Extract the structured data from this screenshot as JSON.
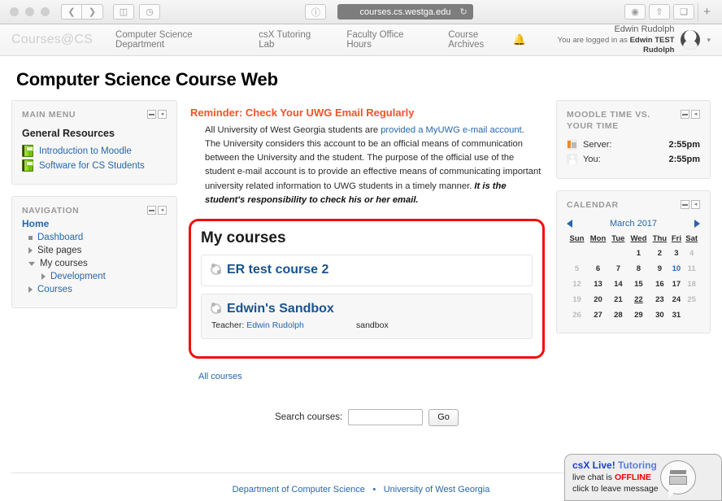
{
  "browser": {
    "url": "courses.cs.westga.edu",
    "back_icon": "chevron-left-icon",
    "forward_icon": "chevron-right-icon",
    "sidebar_icon": "sidebar-icon",
    "history_icon": "clock-icon",
    "reader_icon": "reader-icon",
    "reload_icon": "reload-icon",
    "download_icon": "download-icon",
    "share_icon": "share-icon",
    "tabs_icon": "tab-overview-icon",
    "newtab_label": "+"
  },
  "site_header": {
    "brand": "Courses@CS",
    "nav": [
      {
        "label": "Computer Science Department"
      },
      {
        "label": "csX Tutoring Lab"
      },
      {
        "label": "Faculty Office Hours"
      },
      {
        "label": "Course Archives"
      }
    ],
    "bell_icon": "notification-bell-icon",
    "user_name": "Edwin Rudolph",
    "logged_in_prefix": "You are logged in as ",
    "logged_in_user": "Edwin TEST Rudolph",
    "caret_icon": "chevron-down-icon"
  },
  "page": {
    "title": "Computer Science Course Web"
  },
  "main_menu": {
    "title": "Main menu",
    "collapse_icon": "minus-icon",
    "dock_icon": "dock-left-icon",
    "section_title": "General Resources",
    "resources": [
      {
        "label": "Introduction to Moodle",
        "icon": "book-resource-icon"
      },
      {
        "label": "Software for CS Students",
        "icon": "book-resource-icon"
      }
    ]
  },
  "navigation": {
    "title": "Navigation",
    "collapse_icon": "minus-icon",
    "dock_icon": "dock-left-icon",
    "home": "Home",
    "items": [
      {
        "label": "Dashboard",
        "marker": "square",
        "level": 1,
        "link": true
      },
      {
        "label": "Site pages",
        "marker": "collapsed",
        "level": 1,
        "link": false
      },
      {
        "label": "My courses",
        "marker": "expanded",
        "level": 1,
        "link": false
      },
      {
        "label": "Development",
        "marker": "collapsed",
        "level": 2,
        "link": true
      },
      {
        "label": "Courses",
        "marker": "collapsed",
        "level": 1,
        "link": true
      }
    ]
  },
  "reminder": {
    "title": "Reminder: Check Your UWG Email Regularly",
    "text_1": "All University of West Georgia students are ",
    "link": "provided a MyUWG e-mail account",
    "text_2": ".  The University considers this account to be an official means of communication between the University and the student. The purpose of the official use of the student e-mail account is to provide an effective means of communicating important university related information to UWG students in a timely manner. ",
    "emphasis": "It is the student's responsibility to check his or her email."
  },
  "my_courses": {
    "heading": "My courses",
    "highlight_color": "#f20d0d",
    "courses": [
      {
        "name": "ER test course 2",
        "icon": "course-icon",
        "teacher_label": "",
        "teacher_name": "",
        "summary": ""
      },
      {
        "name": "Edwin's Sandbox",
        "icon": "course-icon",
        "teacher_label": "Teacher: ",
        "teacher_name": "Edwin Rudolph",
        "summary": "sandbox"
      }
    ],
    "all_courses_label": "All courses"
  },
  "course_search": {
    "label": "Search courses:",
    "value": "",
    "placeholder": "",
    "button_label": "Go"
  },
  "moodle_time": {
    "title": "Moodle time vs. your time",
    "collapse_icon": "minus-icon",
    "dock_icon": "dock-left-icon",
    "rows": [
      {
        "label": "Server:",
        "value": "2:55pm",
        "icon": "server-icon"
      },
      {
        "label": "You:",
        "value": "2:55pm",
        "icon": "user-icon"
      }
    ]
  },
  "calendar": {
    "title": "Calendar",
    "collapse_icon": "minus-icon",
    "dock_icon": "dock-left-icon",
    "prev_icon": "arrow-left-icon",
    "next_icon": "arrow-right-icon",
    "month": "March 2017",
    "daynames": [
      "Sun",
      "Mon",
      "Tue",
      "Wed",
      "Thu",
      "Fri",
      "Sat"
    ],
    "weeks": [
      [
        {
          "d": "",
          "weekend": false,
          "today": false,
          "marked": false
        },
        {
          "d": "",
          "weekend": false,
          "today": false,
          "marked": false
        },
        {
          "d": "",
          "weekend": false,
          "today": false,
          "marked": false
        },
        {
          "d": "1",
          "weekend": false,
          "today": false,
          "marked": false
        },
        {
          "d": "2",
          "weekend": false,
          "today": false,
          "marked": false
        },
        {
          "d": "3",
          "weekend": false,
          "today": false,
          "marked": false
        },
        {
          "d": "4",
          "weekend": true,
          "today": false,
          "marked": false
        }
      ],
      [
        {
          "d": "5",
          "weekend": true,
          "today": false,
          "marked": false
        },
        {
          "d": "6",
          "weekend": false,
          "today": false,
          "marked": false
        },
        {
          "d": "7",
          "weekend": false,
          "today": false,
          "marked": false
        },
        {
          "d": "8",
          "weekend": false,
          "today": false,
          "marked": false
        },
        {
          "d": "9",
          "weekend": false,
          "today": false,
          "marked": false
        },
        {
          "d": "10",
          "weekend": false,
          "today": true,
          "marked": false
        },
        {
          "d": "11",
          "weekend": true,
          "today": false,
          "marked": false
        }
      ],
      [
        {
          "d": "12",
          "weekend": true,
          "today": false,
          "marked": false
        },
        {
          "d": "13",
          "weekend": false,
          "today": false,
          "marked": false
        },
        {
          "d": "14",
          "weekend": false,
          "today": false,
          "marked": false
        },
        {
          "d": "15",
          "weekend": false,
          "today": false,
          "marked": false
        },
        {
          "d": "16",
          "weekend": false,
          "today": false,
          "marked": false
        },
        {
          "d": "17",
          "weekend": false,
          "today": false,
          "marked": false
        },
        {
          "d": "18",
          "weekend": true,
          "today": false,
          "marked": false
        }
      ],
      [
        {
          "d": "19",
          "weekend": true,
          "today": false,
          "marked": false
        },
        {
          "d": "20",
          "weekend": false,
          "today": false,
          "marked": false
        },
        {
          "d": "21",
          "weekend": false,
          "today": false,
          "marked": false
        },
        {
          "d": "22",
          "weekend": false,
          "today": false,
          "marked": true
        },
        {
          "d": "23",
          "weekend": false,
          "today": false,
          "marked": false
        },
        {
          "d": "24",
          "weekend": false,
          "today": false,
          "marked": false
        },
        {
          "d": "25",
          "weekend": true,
          "today": false,
          "marked": false
        }
      ],
      [
        {
          "d": "26",
          "weekend": true,
          "today": false,
          "marked": false
        },
        {
          "d": "27",
          "weekend": false,
          "today": false,
          "marked": false
        },
        {
          "d": "28",
          "weekend": false,
          "today": false,
          "marked": false
        },
        {
          "d": "29",
          "weekend": false,
          "today": false,
          "marked": false
        },
        {
          "d": "30",
          "weekend": false,
          "today": false,
          "marked": false
        },
        {
          "d": "31",
          "weekend": false,
          "today": false,
          "marked": false
        },
        {
          "d": "",
          "weekend": true,
          "today": false,
          "marked": false
        }
      ]
    ]
  },
  "footer": {
    "link_1": "Department of Computer Science",
    "separator": "•",
    "link_2": "University of West Georgia"
  },
  "chat_widget": {
    "brand": "csX Live!",
    "brand_suffix": " Tutoring",
    "status_prefix": "live chat is ",
    "status": "OFFLINE",
    "action": "click to leave message",
    "icon": "graduation-cap-chat-icon"
  }
}
